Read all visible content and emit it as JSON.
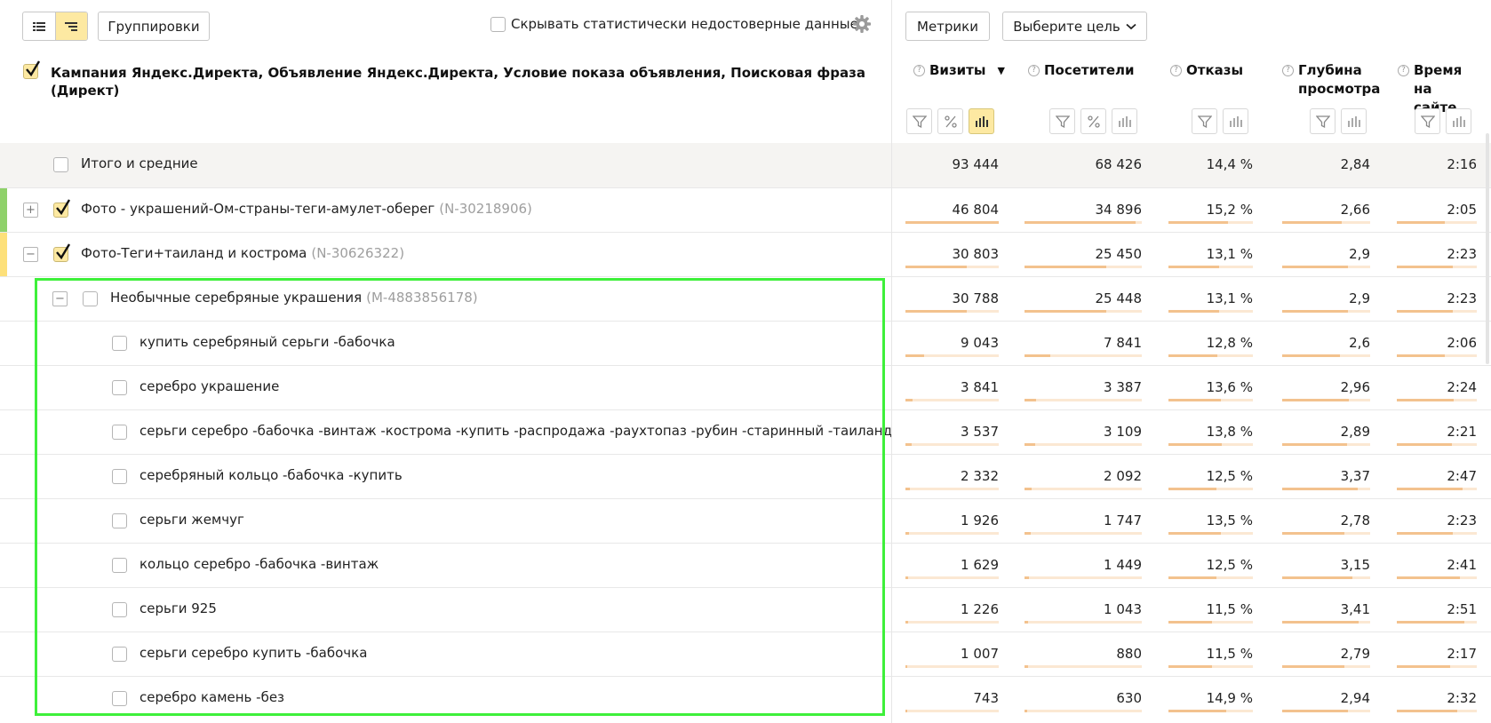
{
  "toolbar": {
    "groupings_label": "Группировки",
    "hide_stat_label": "Скрывать статистически недостоверные данные",
    "metrics_label": "Метрики",
    "goal_label": "Выберите цель"
  },
  "table": {
    "group_header": "Кампания Яндекс.Директа, Объявление Яндекс.Директа, Условие показа объявления, Поисковая фраза (Директ)",
    "columns": [
      {
        "label": "Визиты",
        "sort": "▼"
      },
      {
        "label": "Посетители"
      },
      {
        "label": "Отказы"
      },
      {
        "label": "Глубина просмотра"
      },
      {
        "label": "Время на сайте"
      }
    ],
    "totals": {
      "label": "Итого и средние",
      "values": [
        "93 444",
        "68 426",
        "14,4 %",
        "2,84",
        "2:16"
      ]
    },
    "rows": [
      {
        "label": "Фото - украшений-Ом-страны-теги-амулет-оберег",
        "id": "(N-30218906)",
        "values": [
          "46 804",
          "34 896",
          "15,2 %",
          "2,66",
          "2:05"
        ],
        "fill": [
          1.0,
          0.95,
          0.7,
          0.68,
          0.6
        ]
      },
      {
        "label": "Фото-Теги+таиланд и кострома",
        "id": "(N-30626322)",
        "values": [
          "30 803",
          "25 450",
          "13,1 %",
          "2,9",
          "2:23"
        ],
        "fill": [
          0.66,
          0.7,
          0.6,
          0.75,
          0.7
        ]
      },
      {
        "label": "Необычные серебряные украшения",
        "id": "(M-4883856178)",
        "values": [
          "30 788",
          "25 448",
          "13,1 %",
          "2,9",
          "2:23"
        ],
        "fill": [
          0.66,
          0.7,
          0.6,
          0.75,
          0.7
        ]
      },
      {
        "label": "купить серебряный серьги -бабочка",
        "id": "",
        "values": [
          "9 043",
          "7 841",
          "12,8 %",
          "2,6",
          "2:06"
        ],
        "fill": [
          0.2,
          0.22,
          0.58,
          0.66,
          0.6
        ]
      },
      {
        "label": "серебро украшение",
        "id": "",
        "values": [
          "3 841",
          "3 387",
          "13,6 %",
          "2,96",
          "2:24"
        ],
        "fill": [
          0.08,
          0.1,
          0.62,
          0.76,
          0.71
        ]
      },
      {
        "label": "серьги серебро -бабочка -винтаж -кострома -купить -распродажа -раухтопаз -рубин -старинный -таиланд",
        "id": "",
        "values": [
          "3 537",
          "3 109",
          "13,8 %",
          "2,89",
          "2:21"
        ],
        "fill": [
          0.07,
          0.09,
          0.63,
          0.74,
          0.69
        ]
      },
      {
        "label": "серебряный кольцо -бабочка -купить",
        "id": "",
        "values": [
          "2 332",
          "2 092",
          "12,5 %",
          "3,37",
          "2:47"
        ],
        "fill": [
          0.05,
          0.06,
          0.57,
          0.86,
          0.82
        ]
      },
      {
        "label": "серьги жемчуг",
        "id": "",
        "values": [
          "1 926",
          "1 747",
          "13,5 %",
          "2,78",
          "2:23"
        ],
        "fill": [
          0.04,
          0.05,
          0.62,
          0.71,
          0.7
        ]
      },
      {
        "label": "кольцо серебро -бабочка -винтаж",
        "id": "",
        "values": [
          "1 629",
          "1 449",
          "12,5 %",
          "3,15",
          "2:41"
        ],
        "fill": [
          0.03,
          0.04,
          0.57,
          0.8,
          0.79
        ]
      },
      {
        "label": "серьги 925",
        "id": "",
        "values": [
          "1 226",
          "1 043",
          "11,5 %",
          "3,41",
          "2:51"
        ],
        "fill": [
          0.03,
          0.03,
          0.52,
          0.87,
          0.84
        ]
      },
      {
        "label": "серьги серебро купить -бабочка",
        "id": "",
        "values": [
          "1 007",
          "880",
          "11,5 %",
          "2,79",
          "2:17"
        ],
        "fill": [
          0.02,
          0.03,
          0.52,
          0.71,
          0.67
        ]
      },
      {
        "label": "серебро камень -без",
        "id": "",
        "values": [
          "743",
          "630",
          "14,9 %",
          "2,94",
          "2:32"
        ],
        "fill": [
          0.02,
          0.02,
          0.68,
          0.75,
          0.75
        ]
      }
    ]
  },
  "colors": {
    "accent": "#fde9a2",
    "bar_fill": "#f3c28e",
    "bar_track": "#fbe8d3",
    "row_marker_green": "#8fd16a",
    "row_marker_yellow": "#fde07a",
    "highlight": "#3ef03a"
  }
}
